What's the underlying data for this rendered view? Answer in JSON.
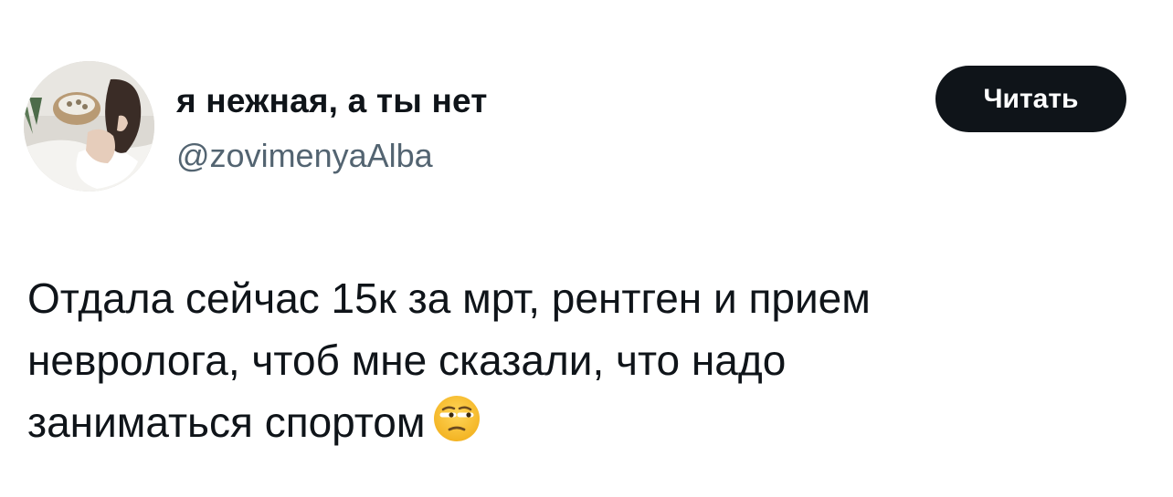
{
  "author": {
    "display_name": "я нежная, а ты нет",
    "handle": "@zovimenyaAlba"
  },
  "follow_button": {
    "label": "Читать"
  },
  "tweet": {
    "lines": [
      "Отдала сейчас 15к за мрт, рентген и прием",
      "невролога, чтоб мне сказали, что надо",
      "заниматься спортом"
    ],
    "emoji": "unamused-face-emoji"
  },
  "colors": {
    "text_primary": "#0f1419",
    "text_secondary": "#536471",
    "button_bg": "#0f1419",
    "button_text": "#ffffff",
    "emoji_face": "#f7c12e"
  }
}
